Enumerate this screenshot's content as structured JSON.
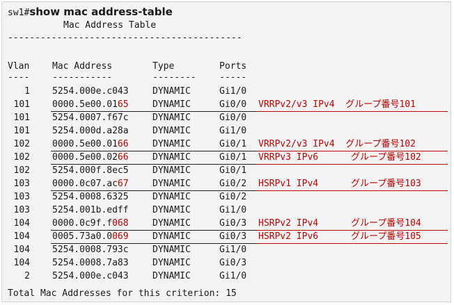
{
  "prompt": {
    "host": "sw1#",
    "command": "show mac address-table"
  },
  "table_title": "Mac Address Table",
  "separator": "-------------------------------------------",
  "headers": {
    "vlan": "Vlan",
    "mac": "Mac Address",
    "type": "Type",
    "ports": "Ports",
    "vlan_dash": "----",
    "mac_dash": "-----------",
    "type_dash": "--------",
    "ports_dash": "-----"
  },
  "rows": [
    {
      "vlan": "1",
      "mac_prefix": "5254.000e.c043",
      "mac_suffix": "",
      "type": "DYNAMIC",
      "port": "Gi1/0",
      "note": "",
      "highlight": false
    },
    {
      "vlan": "101",
      "mac_prefix": "0000.5e00.01",
      "mac_suffix": "65",
      "type": "DYNAMIC",
      "port": "Gi0/0",
      "note": "VRRPv2/v3 IPv4  グループ番号101",
      "highlight": true
    },
    {
      "vlan": "101",
      "mac_prefix": "5254.0007.f67c",
      "mac_suffix": "",
      "type": "DYNAMIC",
      "port": "Gi0/0",
      "note": "",
      "highlight": false
    },
    {
      "vlan": "101",
      "mac_prefix": "5254.000d.a28a",
      "mac_suffix": "",
      "type": "DYNAMIC",
      "port": "Gi1/0",
      "note": "",
      "highlight": false
    },
    {
      "vlan": "102",
      "mac_prefix": "0000.5e00.01",
      "mac_suffix": "66",
      "type": "DYNAMIC",
      "port": "Gi0/1",
      "note": "VRRPv2/v3 IPv4  グループ番号102",
      "highlight": true
    },
    {
      "vlan": "102",
      "mac_prefix": "0000.5e00.02",
      "mac_suffix": "66",
      "type": "DYNAMIC",
      "port": "Gi0/1",
      "note": "VRRPv3 IPv6      グループ番号102",
      "highlight": true
    },
    {
      "vlan": "102",
      "mac_prefix": "5254.000f.8ec5",
      "mac_suffix": "",
      "type": "DYNAMIC",
      "port": "Gi0/1",
      "note": "",
      "highlight": false
    },
    {
      "vlan": "103",
      "mac_prefix": "0000.0c07.ac",
      "mac_suffix": "67",
      "type": "DYNAMIC",
      "port": "Gi0/2",
      "note": "HSRPv1 IPv4      グループ番号103",
      "highlight": true
    },
    {
      "vlan": "103",
      "mac_prefix": "5254.0008.6325",
      "mac_suffix": "",
      "type": "DYNAMIC",
      "port": "Gi0/2",
      "note": "",
      "highlight": false
    },
    {
      "vlan": "103",
      "mac_prefix": "5254.001b.edff",
      "mac_suffix": "",
      "type": "DYNAMIC",
      "port": "Gi1/0",
      "note": "",
      "highlight": false
    },
    {
      "vlan": "104",
      "mac_prefix": "0000.0c9f.f",
      "mac_suffix": "068",
      "type": "DYNAMIC",
      "port": "Gi0/3",
      "note": "HSRPv2 IPv4      グループ番号104",
      "highlight": true
    },
    {
      "vlan": "104",
      "mac_prefix": "0005.73a0.0",
      "mac_suffix": "069",
      "type": "DYNAMIC",
      "port": "Gi0/3",
      "note": "HSRPv2 IPv6      グループ番号105",
      "highlight": true
    },
    {
      "vlan": "104",
      "mac_prefix": "5254.0008.793c",
      "mac_suffix": "",
      "type": "DYNAMIC",
      "port": "Gi1/0",
      "note": "",
      "highlight": false
    },
    {
      "vlan": "104",
      "mac_prefix": "5254.0008.7a83",
      "mac_suffix": "",
      "type": "DYNAMIC",
      "port": "Gi0/3",
      "note": "",
      "highlight": false
    },
    {
      "vlan": "2",
      "mac_prefix": "5254.000e.c043",
      "mac_suffix": "",
      "type": "DYNAMIC",
      "port": "Gi1/0",
      "note": "",
      "highlight": false
    }
  ],
  "total": "Total Mac Addresses for this criterion: 15",
  "colors": {
    "accent_red": "#c00000",
    "background": "#f3f3f3",
    "text": "#1a1a1a"
  }
}
